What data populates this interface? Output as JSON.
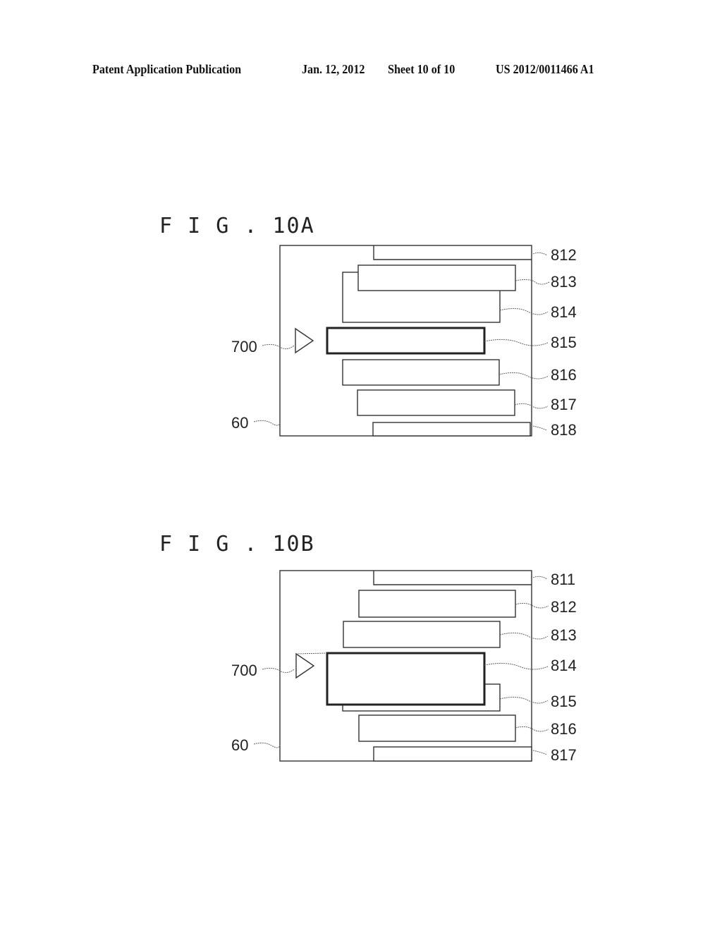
{
  "header": {
    "publication": "Patent Application Publication",
    "date": "Jan. 12, 2012",
    "sheet": "Sheet 10 of 10",
    "number": "US 2012/0011466 A1"
  },
  "figures": [
    {
      "title": "F I G . 10A",
      "labels": {
        "frame": "60",
        "triangle": "700",
        "layers": [
          "812",
          "813",
          "814",
          "815",
          "816",
          "817",
          "818"
        ]
      },
      "highlighted_layer": "815"
    },
    {
      "title": "F I G . 10B",
      "labels": {
        "frame": "60",
        "triangle": "700",
        "layers": [
          "811",
          "812",
          "813",
          "814",
          "815",
          "816",
          "817"
        ]
      },
      "highlighted_layer": "814"
    }
  ]
}
